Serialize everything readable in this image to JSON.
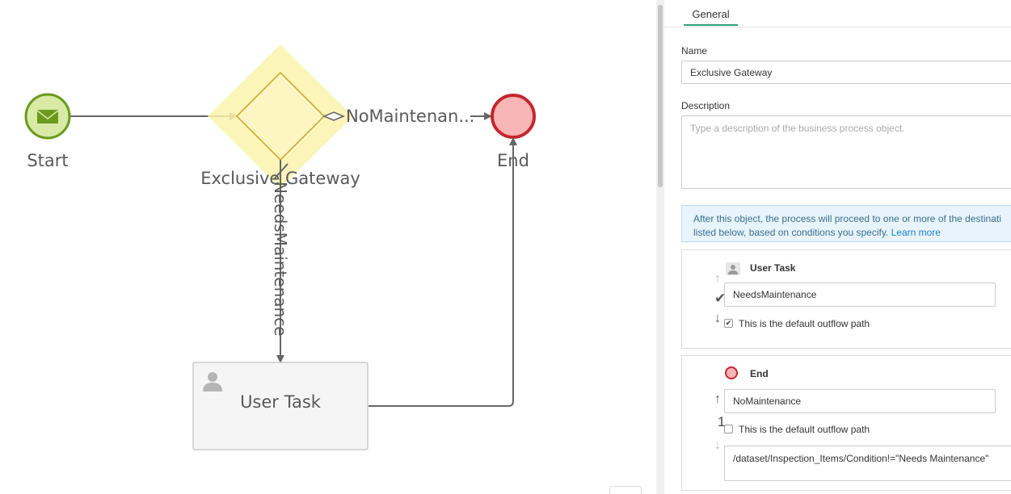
{
  "diagram": {
    "start_label": "Start",
    "gateway_label": "Exclusive Gateway",
    "end_label": "End",
    "user_task_label": "User Task",
    "flow_no_maintenance_label": "NoMaintenan...",
    "flow_needs_maintenance_label": "NeedsMaintenance",
    "colors": {
      "start_fill": "#d8eaa6",
      "start_stroke": "#6b9a1e",
      "gateway_fill": "#fdf6c3",
      "gateway_halo": "#fcf3ae",
      "gateway_stroke": "#c9a227",
      "end_fill": "#f8b6b6",
      "end_stroke": "#c4262e",
      "flow": "#666666",
      "task_fill": "#f5f5f5",
      "task_stroke": "#cccccc"
    }
  },
  "panel": {
    "tab_general": "General",
    "name_label": "Name",
    "name_value": "Exclusive Gateway",
    "description_label": "Description",
    "description_placeholder": "Type a description of the business process object.",
    "info_text_line1": "After this object, the process will proceed to one or more of the destinati",
    "info_text_line2": "listed below, based on conditions you specify.",
    "info_link": "Learn more",
    "outflows": [
      {
        "target": "User Task",
        "name": "NeedsMaintenance",
        "default_label": "This is the default outflow path",
        "is_default": true,
        "icon": "user-icon"
      },
      {
        "target": "End",
        "name": "NoMaintenance",
        "order": "1",
        "default_label": "This is the default outflow path",
        "is_default": false,
        "condition": "/dataset/Inspection_Items/Condition!=\"Needs Maintenance\"",
        "icon": "end-event-icon"
      }
    ],
    "icons": {
      "up": "arrow-up-icon",
      "down": "arrow-down-icon",
      "check": "checkmark-icon"
    }
  }
}
